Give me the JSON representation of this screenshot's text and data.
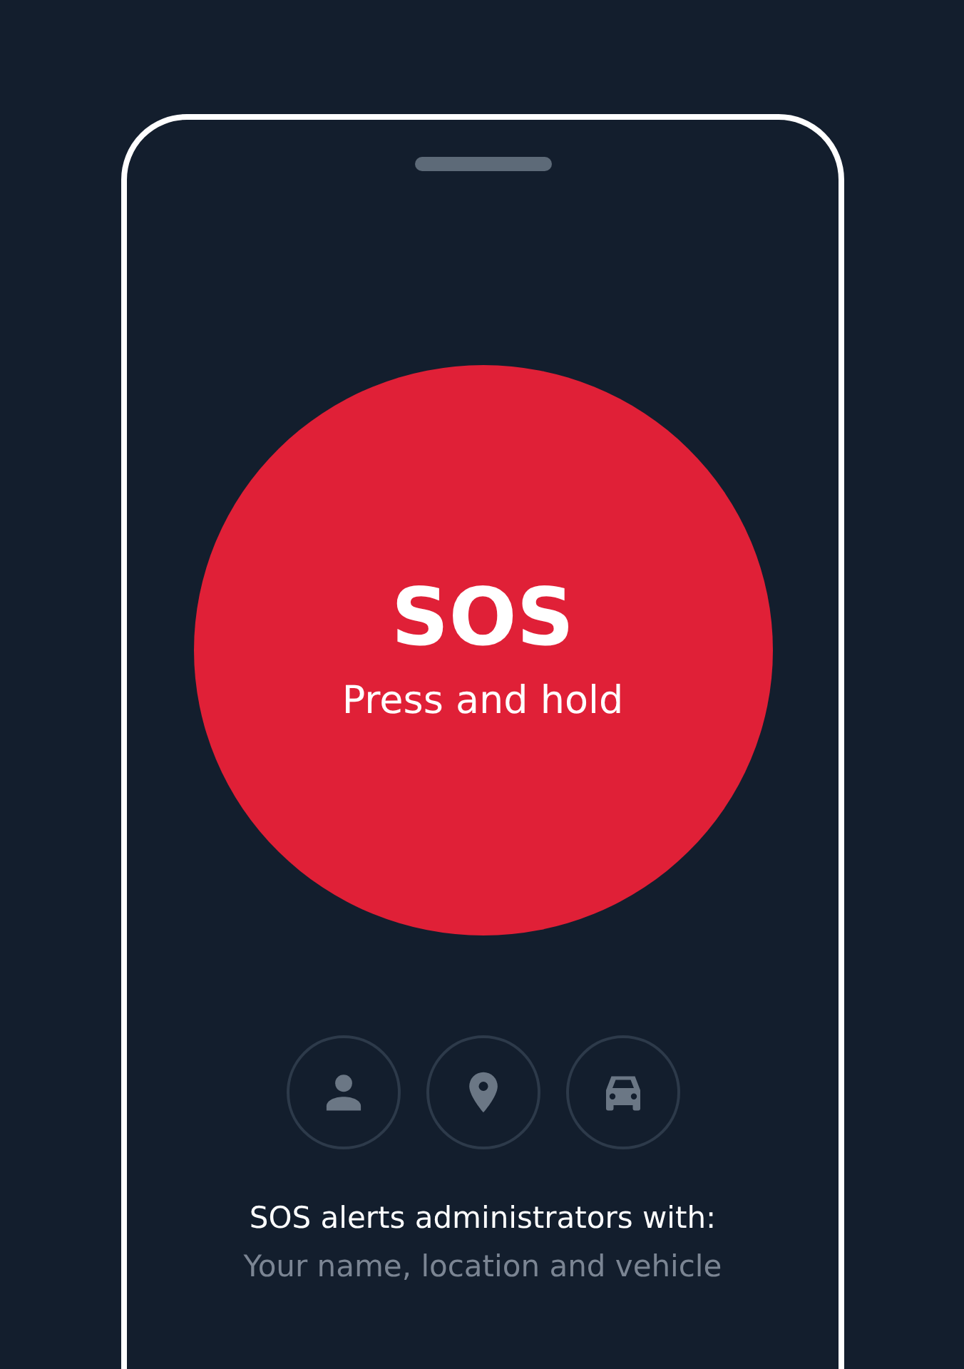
{
  "sos_button": {
    "title": "SOS",
    "subtitle": "Press and hold"
  },
  "info": {
    "heading": "SOS alerts administrators with:",
    "detail": "Your name, location and vehicle"
  }
}
